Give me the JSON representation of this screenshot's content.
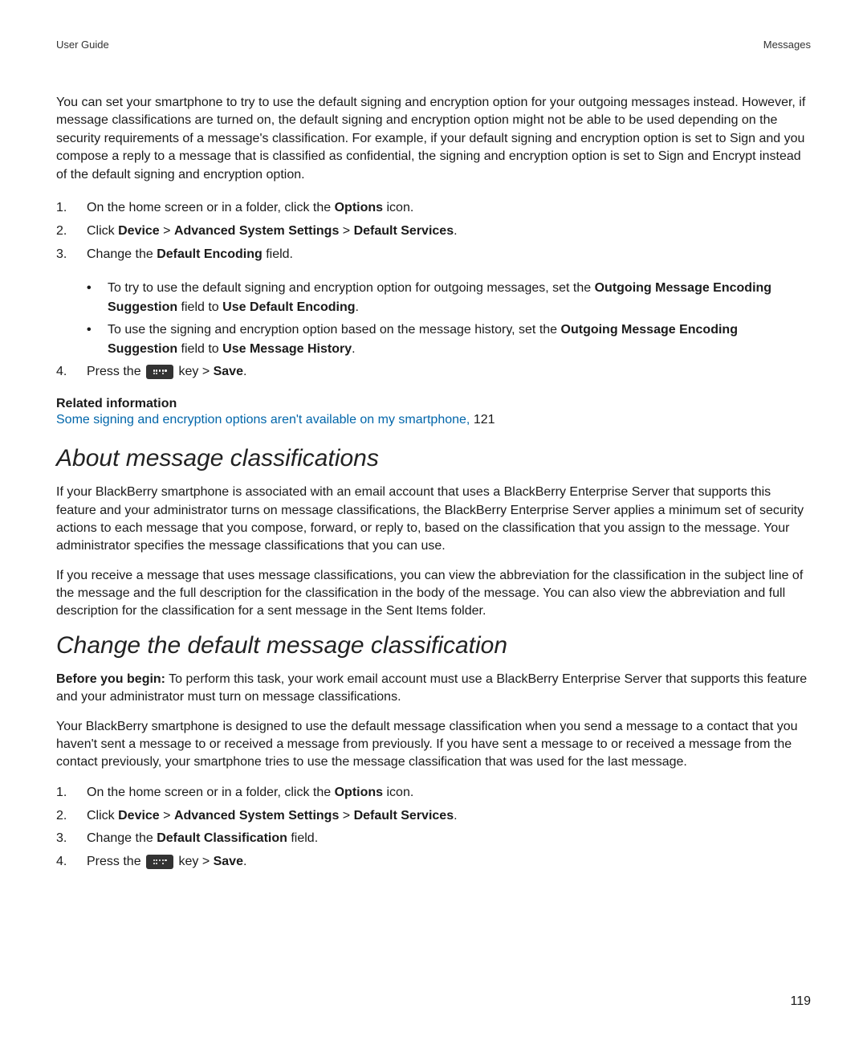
{
  "header": {
    "left": "User Guide",
    "right": "Messages"
  },
  "intro": "You can set your smartphone to try to use the default signing and encryption option for your outgoing messages instead. However, if message classifications are turned on, the default signing and encryption option might not be able to be used depending on the security requirements of a message's classification. For example, if your default signing and encryption option is set to Sign and you compose a reply to a message that is classified as confidential, the signing and encryption option is set to Sign and Encrypt instead of the default signing and encryption option.",
  "steps1": {
    "s1": {
      "num": "1.",
      "pre": "On the home screen or in a folder, click the ",
      "b1": "Options",
      "post": " icon."
    },
    "s2": {
      "num": "2.",
      "pre": "Click ",
      "b1": "Device",
      "sep1": " > ",
      "b2": "Advanced System Settings",
      "sep2": " > ",
      "b3": "Default Services",
      "post": "."
    },
    "s3": {
      "num": "3.",
      "pre": "Change the ",
      "b1": "Default Encoding",
      "post": " field.",
      "sub1": {
        "pre": "To try to use the default signing and encryption option for outgoing messages, set the ",
        "b1": "Outgoing Message Encoding Suggestion",
        "mid": " field to ",
        "b2": "Use Default Encoding",
        "post": "."
      },
      "sub2": {
        "pre": "To use the signing and encryption option based on the message history, set the ",
        "b1": "Outgoing Message Encoding Suggestion",
        "mid": " field to ",
        "b2": "Use Message History",
        "post": "."
      }
    },
    "s4": {
      "num": "4.",
      "pre": "Press the ",
      "mid": " key > ",
      "b1": "Save",
      "post": "."
    }
  },
  "related": {
    "heading": "Related information",
    "link": "Some signing and encryption options aren't available on my smartphone, ",
    "page": "121"
  },
  "section1": {
    "heading": "About message classifications",
    "para1": "If your BlackBerry smartphone is associated with an email account that uses a BlackBerry Enterprise Server that supports this feature and your administrator turns on message classifications, the BlackBerry Enterprise Server applies a minimum set of security actions to each message that you compose, forward, or reply to, based on the classification that you assign to the message. Your administrator specifies the message classifications that you can use.",
    "para2": "If you receive a message that uses message classifications, you can view the abbreviation for the classification in the subject line of the message and the full description for the classification in the body of the message. You can also view the abbreviation and full description for the classification for a sent message in the Sent Items folder."
  },
  "section2": {
    "heading": "Change the default message classification",
    "before": {
      "b1": "Before you begin:",
      "text": " To perform this task, your work email account must use a BlackBerry Enterprise Server that supports this feature and your administrator must turn on message classifications."
    },
    "para2": "Your BlackBerry smartphone is designed to use the default message classification when you send a message to a contact that you haven't sent a message to or received a message from previously. If you have sent a message to or received a message from the contact previously, your smartphone tries to use the message classification that was used for the last message."
  },
  "steps2": {
    "s1": {
      "num": "1.",
      "pre": "On the home screen or in a folder, click the ",
      "b1": "Options",
      "post": " icon."
    },
    "s2": {
      "num": "2.",
      "pre": "Click ",
      "b1": "Device",
      "sep1": " > ",
      "b2": "Advanced System Settings",
      "sep2": " > ",
      "b3": "Default Services",
      "post": "."
    },
    "s3": {
      "num": "3.",
      "pre": "Change the ",
      "b1": "Default Classification",
      "post": " field."
    },
    "s4": {
      "num": "4.",
      "pre": "Press the ",
      "mid": " key > ",
      "b1": "Save",
      "post": "."
    }
  },
  "pageNumber": "119"
}
